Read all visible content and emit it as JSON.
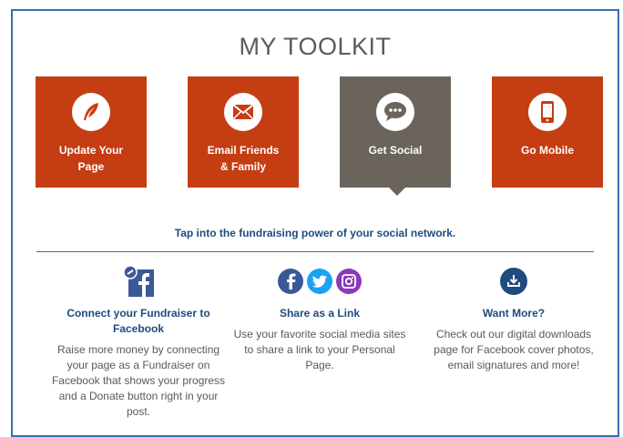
{
  "toolkit": {
    "title": "MY TOOLKIT",
    "tiles": [
      {
        "label": "Update Your\nPage",
        "icon": "quill-icon"
      },
      {
        "label": "Email Friends\n& Family",
        "icon": "envelope-icon"
      },
      {
        "label": "Get Social",
        "icon": "chat-bubble-icon",
        "active": true
      },
      {
        "label": "Go Mobile",
        "icon": "mobile-phone-icon"
      }
    ],
    "tagline": "Tap into the fundraising power of your social network."
  },
  "columns": [
    {
      "title": "Connect your Fundraiser to Facebook",
      "text": "Raise more money by connecting your page as a Fundraiser on Facebook that shows your progress and a Donate button right in your post.",
      "icon": "facebook-link-icon"
    },
    {
      "title": "Share as a Link",
      "text": "Use your favorite social media sites to share a link to your Personal Page.",
      "icons": [
        "facebook-icon",
        "twitter-icon",
        "instagram-icon"
      ]
    },
    {
      "title": "Want More?",
      "text": "Check out our digital downloads page for Facebook cover photos, email signatures and more!",
      "icon": "download-icon"
    }
  ],
  "colors": {
    "tile": "#c53d13",
    "tile_active": "#6b645c",
    "heading_blue": "#1f4b7f",
    "facebook": "#3b5998",
    "twitter": "#1da1f2",
    "instagram": "#8a3ab9"
  }
}
